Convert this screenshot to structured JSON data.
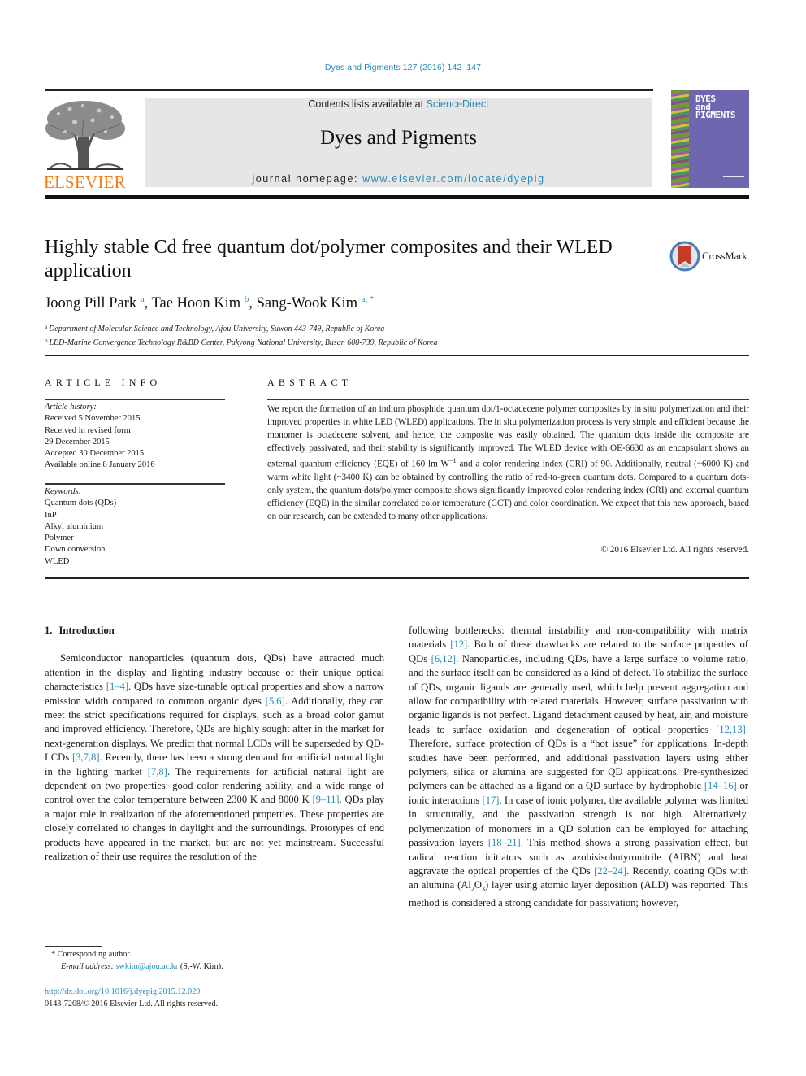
{
  "citation": "Dyes and Pigments 127 (2016) 142–147",
  "header": {
    "publisher": "ELSEVIER",
    "contents_prefix": "Contents lists available at ",
    "contents_link": "ScienceDirect",
    "journal_name": "Dyes and Pigments",
    "homepage_prefix": "journal homepage: ",
    "homepage_link": "www.elsevier.com/locate/dyepig",
    "cover_title": [
      "DYES",
      "and",
      "PIGMENTS"
    ],
    "colors": {
      "link": "#2a8ab8",
      "publisher_orange": "#f07d1a",
      "cover_purple": "#6f66b0",
      "masthead_gray": "#e6e6e6"
    }
  },
  "article": {
    "title": "Highly stable Cd free quantum dot/polymer composites and their WLED application",
    "crossmark_label": "CrossMark",
    "authors": [
      {
        "name": "Joong Pill Park",
        "affil": "a"
      },
      {
        "name": "Tae Hoon Kim",
        "affil": "b"
      },
      {
        "name": "Sang-Wook Kim",
        "affil": "a, *"
      }
    ],
    "affiliations": [
      {
        "mark": "a",
        "text": "Department of Molecular Science and Technology, Ajou University, Suwon 443-749, Republic of Korea"
      },
      {
        "mark": "b",
        "text": "LED-Marine Convergence Technology R&BD Center, Pukyong National University, Busan 608-739, Republic of Korea"
      }
    ]
  },
  "article_info": {
    "heading": "ARTICLE INFO",
    "history_label": "Article history:",
    "history": [
      "Received 5 November 2015",
      "Received in revised form",
      "29 December 2015",
      "Accepted 30 December 2015",
      "Available online 8 January 2016"
    ],
    "keywords_label": "Keywords:",
    "keywords": [
      "Quantum dots (QDs)",
      "InP",
      "Alkyl aluminium",
      "Polymer",
      "Down conversion",
      "WLED"
    ]
  },
  "abstract": {
    "heading": "ABSTRACT",
    "text_part1": "We report the formation of an indium phosphide quantum dot/1-octadecene polymer composites by in situ polymerization and their improved properties in white LED (WLED) applications. The in situ poly­merization process is very simple and efficient because the monomer is octadecene solvent, and hence, the composite was easily obtained. The quantum dots inside the composite are effectively passivated, and their stability is significantly improved. The WLED device with OE-6630 as an encapsulant shows an external quantum efficiency (EQE) of 160 lm W",
    "text_sup": "−1",
    "text_part2": " and a color rendering index (CRI) of 90. Additionally, neutral (~6000 K) and warm white light (~3400 K) can be obtained by controlling the ratio of red-to-green quantum dots. Compared to a quantum dots-only system, the quantum dots/polymer composite shows significantly improved color rendering index (CRI) and external quantum efficiency (EQE) in the similar correlated color temperature (CCT) and color coordination. We expect that this new approach, based on our research, can be extended to many other applications.",
    "copyright": "© 2016 Elsevier Ltd. All rights reserved."
  },
  "introduction": {
    "number": "1.",
    "heading": "Introduction",
    "left_segments": [
      {
        "t": "Semiconductor nanoparticles (quantum dots, QDs) have attracted much attention in the display and lighting industry because of their unique optical characteristics "
      },
      {
        "c": "[1–4]"
      },
      {
        "t": ". QDs have size-tunable optical properties and show a narrow emission width compared to common organic dyes "
      },
      {
        "c": "[5,6]"
      },
      {
        "t": ". Additionally, they can meet the strict specifications required for displays, such as a broad color gamut and improved efficiency. Therefore, QDs are highly sought after in the market for next-generation displays. We predict that normal LCDs will be superseded by QD-LCDs "
      },
      {
        "c": "[3,7,8]"
      },
      {
        "t": ". Recently, there has been a strong demand for artificial natural light in the lighting market "
      },
      {
        "c": "[7,8]"
      },
      {
        "t": ". The requirements for artificial natural light are dependent on two properties: good color rendering ability, and a wide range of control over the color temperature between 2300 K and 8000 K "
      },
      {
        "c": "[9–11]"
      },
      {
        "t": ". QDs play a major role in realization of the aforementioned properties. These properties are closely correlated to changes in daylight and the surroundings. Prototypes of end products have appeared in the market, but are not yet mainstream. Successful realization of their use requires the resolution of the"
      }
    ],
    "right_segments": [
      {
        "t": "following bottlenecks: thermal instability and non-compatibility with matrix materials "
      },
      {
        "c": "[12]"
      },
      {
        "t": ". Both of these drawbacks are related to the surface properties of QDs "
      },
      {
        "c": "[6,12]"
      },
      {
        "t": ". Nanoparticles, including QDs, have a large surface to volume ratio, and the surface itself can be considered as a kind of defect. To stabilize the surface of QDs, organic ligands are generally used, which help prevent aggregation and allow for compatibility with related materials. However, sur­face passivation with organic ligands is not perfect. Ligand detachment caused by heat, air, and moisture leads to surface oxidation and degeneration of optical properties "
      },
      {
        "c": "[12,13]"
      },
      {
        "t": ". Therefore, surface protection of QDs is a “hot issue” for applications. In-depth studies have been performed, and additional passivation layers using either polymers, silica or alumina are suggested for QD ap­plications. Pre-synthesized polymers can be attached as a ligand on a QD surface by hydrophobic "
      },
      {
        "c": "[14–16]"
      },
      {
        "t": " or ionic interactions "
      },
      {
        "c": "[17]"
      },
      {
        "t": ". In case of ionic polymer, the available polymer was limited in struc­turally, and the passivation strength is not high. Alternatively, polymerization of monomers in a QD solution can be employed for attaching passivation layers "
      },
      {
        "c": "[18–21]"
      },
      {
        "t": ". This method shows a strong passivation effect, but radical reaction initiators such as azobisiso­butyronitrile (AIBN) and heat aggravate the optical properties of the QDs "
      },
      {
        "c": "[22–24]"
      },
      {
        "t": ". Recently, coating QDs with an alumina (Al"
      },
      {
        "sub": "2"
      },
      {
        "t": "O"
      },
      {
        "sub": "3"
      },
      {
        "t": ") layer using atomic layer deposition (ALD) was reported. This method is considered a strong candidate for passivation; however,"
      }
    ]
  },
  "footnotes": {
    "corresponding": "* Corresponding author.",
    "email_label": "E-mail address: ",
    "email": "swkim@ajou.ac.kr",
    "email_suffix": " (S.-W. Kim).",
    "doi": "http://dx.doi.org/10.1016/j.dyepig.2015.12.029",
    "issn_copyright": "0143-7208/© 2016 Elsevier Ltd. All rights reserved."
  }
}
